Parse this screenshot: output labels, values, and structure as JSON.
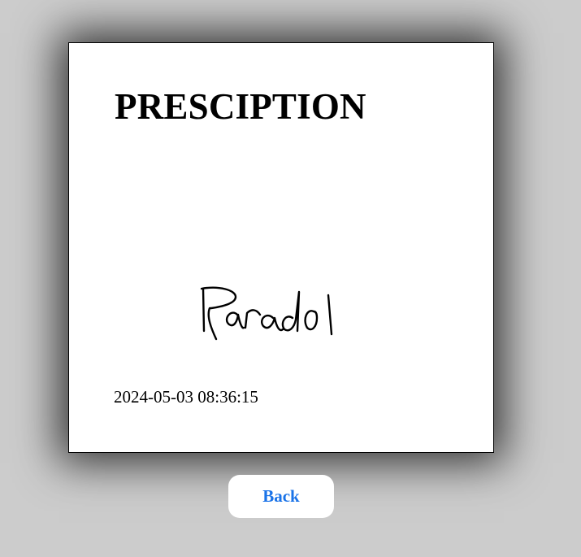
{
  "prescription": {
    "title": "PRESCIPTION",
    "signature_text": "Paradol",
    "timestamp": "2024-05-03 08:36:15"
  },
  "actions": {
    "back_label": "Back"
  },
  "colors": {
    "background": "#cccccc",
    "card": "#ffffff",
    "link_blue": "#1a73e8"
  }
}
